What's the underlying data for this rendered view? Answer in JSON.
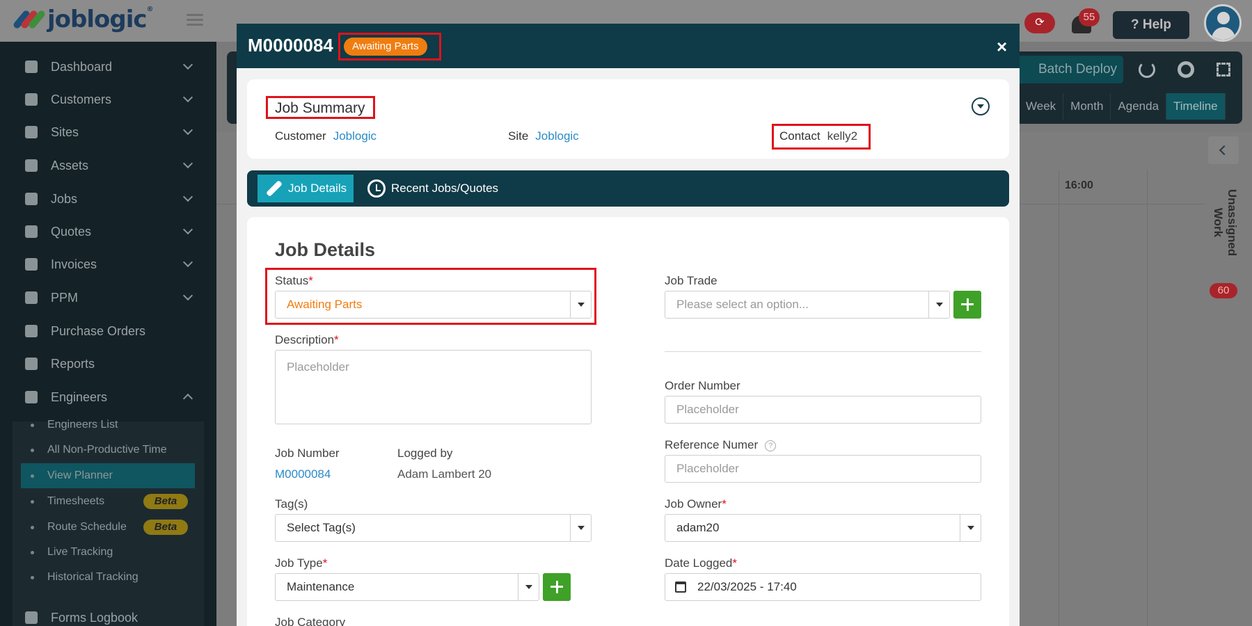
{
  "app": {
    "logo_text": "joblogic",
    "notification_count": "55",
    "help_label": "Help"
  },
  "sidebar": {
    "items": [
      {
        "label": "Dashboard"
      },
      {
        "label": "Customers"
      },
      {
        "label": "Sites"
      },
      {
        "label": "Assets"
      },
      {
        "label": "Jobs"
      },
      {
        "label": "Quotes"
      },
      {
        "label": "Invoices"
      },
      {
        "label": "PPM"
      },
      {
        "label": "Purchase Orders"
      },
      {
        "label": "Reports"
      },
      {
        "label": "Engineers"
      }
    ],
    "engineers_sub": [
      {
        "label": "Engineers List"
      },
      {
        "label": "All Non-Productive Time"
      },
      {
        "label": "View Planner"
      },
      {
        "label": "Timesheets",
        "badge": "Beta"
      },
      {
        "label": "Route Schedule",
        "badge": "Beta"
      },
      {
        "label": "Live Tracking"
      },
      {
        "label": "Historical Tracking"
      }
    ],
    "forms_logbook": "Forms Logbook"
  },
  "planner": {
    "batch_deploy_label": "Batch Deploy",
    "view_tabs": [
      "Week",
      "Month",
      "Agenda",
      "Timeline"
    ],
    "time_label": "16:00",
    "unassigned_label": "Unassigned Work",
    "unassigned_count": "60"
  },
  "modal": {
    "job_id": "M0000084",
    "status_pill": "Awaiting Parts",
    "close_label": "×",
    "summary": {
      "title": "Job Summary",
      "customer_label": "Customer",
      "customer_value": "Joblogic",
      "site_label": "Site",
      "site_value": "Joblogic",
      "contact_label": "Contact",
      "contact_value": "kelly2"
    },
    "tabs": [
      {
        "label": "Job Details"
      },
      {
        "label": "Recent Jobs/Quotes"
      }
    ],
    "details": {
      "title": "Job Details",
      "status_label": "Status",
      "status_value": "Awaiting Parts",
      "job_trade_label": "Job Trade",
      "job_trade_placeholder": "Please select an option...",
      "description_label": "Description",
      "description_placeholder": "Placeholder",
      "order_number_label": "Order Number",
      "order_number_placeholder": "Placeholder",
      "reference_label": "Reference Numer",
      "reference_placeholder": "Placeholder",
      "job_number_label": "Job Number",
      "job_number_value": "M0000084",
      "logged_by_label": "Logged by",
      "logged_by_value": "Adam Lambert 20",
      "tags_label": "Tag(s)",
      "tags_placeholder": "Select Tag(s)",
      "job_owner_label": "Job Owner",
      "job_owner_value": "adam20",
      "job_type_label": "Job Type",
      "job_type_value": "Maintenance",
      "date_logged_label": "Date Logged",
      "date_logged_value": "22/03/2025 - 17:40",
      "job_category_label": "Job Category",
      "required_mark": "*"
    }
  },
  "colors": {
    "modal_header": "#0f3a47",
    "status_orange": "#f07d10",
    "link_blue": "#2a8bc9",
    "add_green": "#3fa128",
    "highlight_red": "#e0121b",
    "active_tab": "#17a2b8"
  }
}
